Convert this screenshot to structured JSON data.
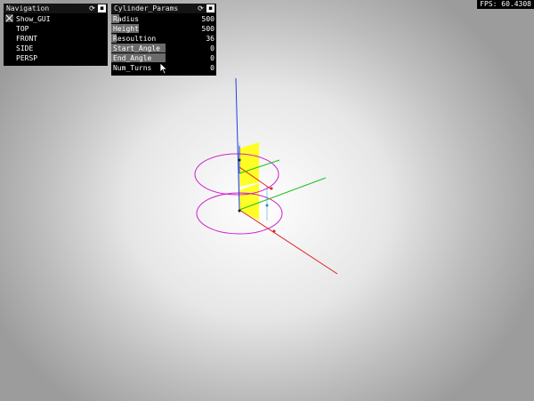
{
  "fps": {
    "label": "FPS: 60.4308"
  },
  "navigation": {
    "title": "Navigation",
    "toggle": {
      "label": "Show_GUI",
      "checked": true
    },
    "buttons": [
      "TOP",
      "FRONT",
      "SIDE",
      "PERSP"
    ]
  },
  "cylinder_params": {
    "title": "Cylinder_Params",
    "sliders": [
      {
        "label": "Radius",
        "value": "500",
        "fill": 0.08
      },
      {
        "label": "Height",
        "value": "500",
        "fill": 0.26
      },
      {
        "label": "Resoultion",
        "value": "36",
        "fill": 0.05
      },
      {
        "label": "Start_Angle",
        "value": "0",
        "fill": 0.52
      },
      {
        "label": "End_Angle",
        "value": "0",
        "fill": 0.52
      },
      {
        "label": "Num_Turns",
        "value": "0",
        "fill": 0
      }
    ]
  },
  "colors": {
    "x_axis": "#e02020",
    "y_axis": "#20c020",
    "z_axis": "#2040e0",
    "circle": "#d020d0",
    "plane": "#ffff00"
  }
}
